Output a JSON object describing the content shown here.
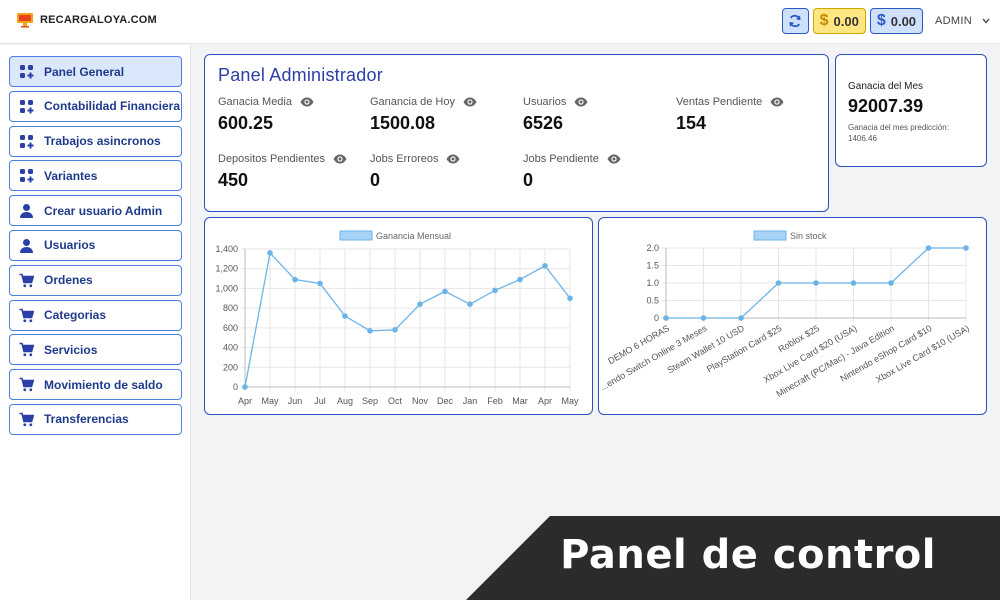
{
  "header": {
    "brand": "RECARGALOYA.COM",
    "balances": [
      {
        "currency": "$",
        "amount": "0.00",
        "color": "#ffe680"
      },
      {
        "currency": "$",
        "amount": "0.00",
        "color": "#cfe0fb"
      }
    ],
    "user": "ADMIN",
    "icons": {
      "refresh": "refresh-icon",
      "dropdown": "chevron-down-icon"
    }
  },
  "sidebar": {
    "items": [
      {
        "label": "Panel General",
        "icon": "grid-plus-icon",
        "active": true
      },
      {
        "label": "Contabilidad Financiera",
        "icon": "grid-plus-icon"
      },
      {
        "label": "Trabajos asincronos",
        "icon": "grid-plus-icon"
      },
      {
        "label": "Variantes",
        "icon": "grid-plus-icon"
      },
      {
        "label": "Crear usuario Admin",
        "icon": "user-icon"
      },
      {
        "label": "Usuarios",
        "icon": "user-icon"
      },
      {
        "label": "Ordenes",
        "icon": "cart-icon"
      },
      {
        "label": "Categorias",
        "icon": "cart-icon"
      },
      {
        "label": "Servicios",
        "icon": "cart-icon"
      },
      {
        "label": "Movimiento de saldo",
        "icon": "cart-icon"
      },
      {
        "label": "Transferencias",
        "icon": "cart-icon"
      }
    ]
  },
  "dashboard": {
    "title": "Panel Administrador",
    "stats": [
      {
        "label": "Ganacia Media",
        "value": "600.25"
      },
      {
        "label": "Ganancia de Hoy",
        "value": "1500.08"
      },
      {
        "label": "Usuarios",
        "value": "6526"
      },
      {
        "label": "Ventas Pendiente",
        "value": "154"
      },
      {
        "label": "Depositos Pendientes",
        "value": "450"
      },
      {
        "label": "Jobs Erroreos",
        "value": "0"
      },
      {
        "label": "Jobs Pendiente",
        "value": "0"
      }
    ]
  },
  "month": {
    "title": "Ganacia del Mes",
    "value": "92007.39",
    "prediction_label": "Ganacia del mes predicción:",
    "prediction_value": "1406.46"
  },
  "chart_data": [
    {
      "type": "line",
      "categories": [
        "Apr",
        "May",
        "Jun",
        "Jul",
        "Aug",
        "Sep",
        "Oct",
        "Nov",
        "Dec",
        "Jan",
        "Feb",
        "Mar",
        "Apr",
        "May"
      ],
      "series": [
        {
          "name": "Ganancia Mensual",
          "values": [
            0,
            1360,
            1090,
            1050,
            720,
            570,
            580,
            840,
            970,
            840,
            980,
            1090,
            1230,
            900
          ]
        }
      ],
      "ylim": [
        0,
        1400
      ],
      "yticks": [
        "0",
        "200",
        "400",
        "600",
        "800",
        "1,000",
        "1,200",
        "1,400"
      ],
      "grid": true,
      "legend": "top",
      "color": "#6cb4e8"
    },
    {
      "type": "line",
      "categories": [
        "DEMO 6 HORAS",
        "...endo Switch Online 3 Meses",
        "Steam Wallet 10 USD",
        "PlayStation Card $25",
        "Roblox $25",
        "Xbox Live Card $20 (USA)",
        "Minecraft (PC/Mac) - Java Edition",
        "Nintendo eShop Card $10",
        "Xbox Live Card $10 (USA)"
      ],
      "series": [
        {
          "name": "Sin stock",
          "values": [
            0,
            0,
            0,
            1,
            1,
            1,
            1,
            2,
            2
          ]
        }
      ],
      "ylim": [
        0,
        2
      ],
      "yticks": [
        "0",
        "0.5",
        "1.0",
        "1.5",
        "2.0"
      ],
      "grid": true,
      "legend": "top",
      "color": "#6cb4e8"
    }
  ],
  "banner": {
    "text": "Panel de control",
    "color": "#2b2b2b"
  }
}
